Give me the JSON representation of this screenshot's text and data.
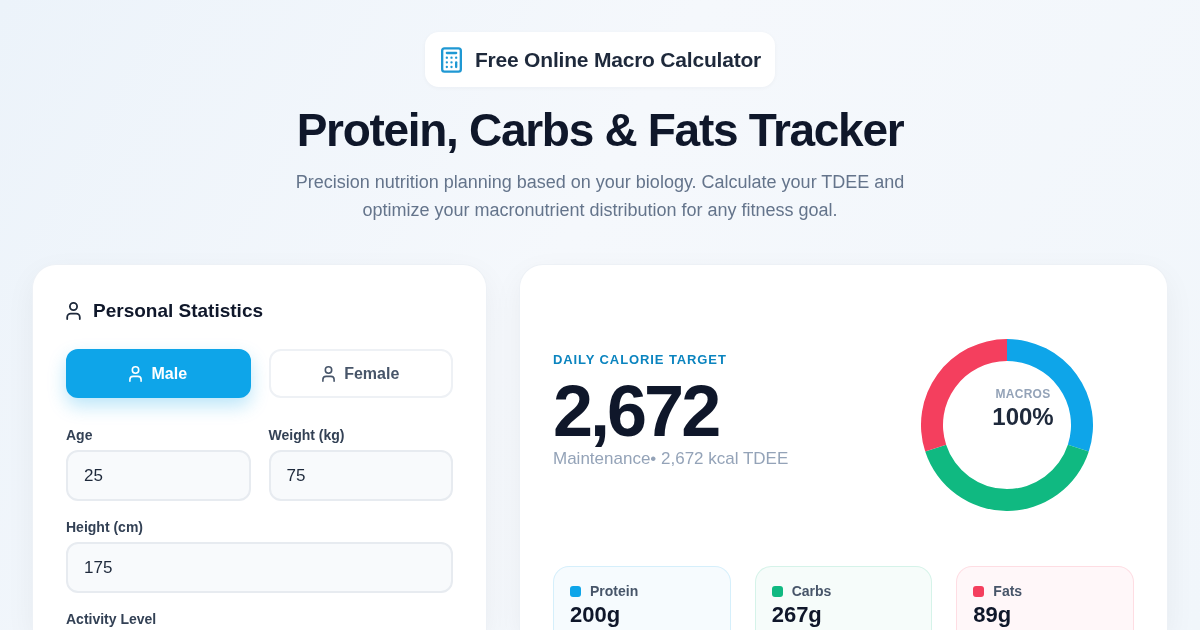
{
  "badge": {
    "title": "Free Online Macro Calculator"
  },
  "hero": {
    "title": "Protein, Carbs & Fats Tracker",
    "subtitle": "Precision nutrition planning based on your biology. Calculate your TDEE and optimize your macronutrient distribution for any fitness goal."
  },
  "personal_statistics": {
    "title": "Personal Statistics",
    "gender_options": [
      {
        "label": "Male",
        "selected": true
      },
      {
        "label": "Female",
        "selected": false
      }
    ],
    "field_rows": [
      {
        "fields": [
          {
            "label": "Age",
            "value": "25"
          },
          {
            "label": "Weight (kg)",
            "value": "75"
          }
        ]
      },
      {
        "fields": [
          {
            "label": "Height (cm)",
            "value": "175"
          }
        ]
      }
    ],
    "activity_level": {
      "label": "Activity Level"
    }
  },
  "results": {
    "eyebrow": "DAILY CALORIE TARGET",
    "calories": "2,672",
    "summary": "Maintenance• 2,672 kcal TDEE",
    "macro_chart": {
      "center_label": "MACROS",
      "center_value": "100%",
      "chart_data": {
        "type": "donut",
        "values": [
          30,
          40,
          30
        ]
      }
    },
    "macros": [
      {
        "name": "Protein",
        "value": "200g",
        "color": "#0ea5e9"
      },
      {
        "name": "Carbs",
        "value": "267g",
        "color": "#10b981"
      },
      {
        "name": "Fats",
        "value": "89g",
        "color": "#f43f5e"
      }
    ]
  }
}
